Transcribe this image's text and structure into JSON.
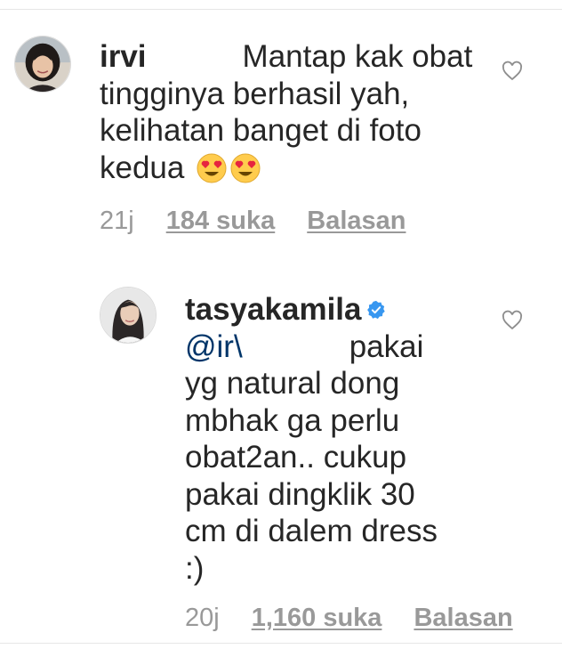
{
  "comments": [
    {
      "username": "irvi",
      "text": "Mantap kak obat tingginya berhasil yah, kelihatan banget di foto kedua",
      "emoji": [
        "heart-eyes",
        "heart-eyes"
      ],
      "time": "21j",
      "likes": "184 suka",
      "reply_label": "Balasan"
    },
    {
      "username": "tasyakamila",
      "verified": true,
      "mention": "@ir\\",
      "text": "pakai yg natural dong mbhak ga perlu obat2an.. cukup pakai dingklik 30 cm di dalem dress :)",
      "time": "20j",
      "likes": "1,160 suka",
      "reply_label": "Balasan"
    }
  ],
  "colors": {
    "text": "#262626",
    "secondary": "#999999",
    "mention": "#003569",
    "verified": "#3897f0"
  }
}
